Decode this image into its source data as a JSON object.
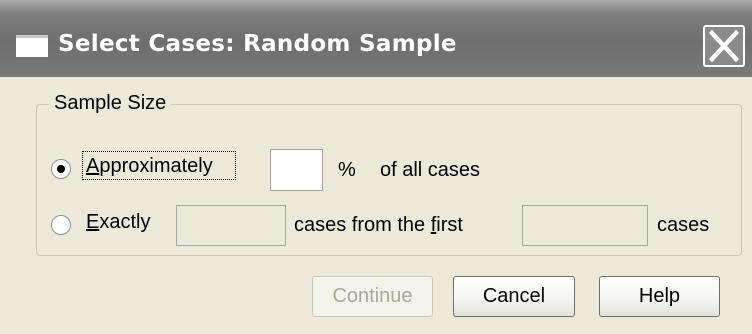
{
  "window": {
    "title": "Select Cases: Random Sample",
    "close_glyph": "✕"
  },
  "sample_size": {
    "group_label": "Sample Size",
    "approximately": {
      "label_prefix": "",
      "label_mnemonic": "A",
      "label_rest": "pproximately",
      "selected": true,
      "value": "",
      "percent_symbol": "%",
      "suffix": "of all cases"
    },
    "exactly": {
      "label_mnemonic": "E",
      "label_rest": "xactly",
      "selected": false,
      "count_value": "",
      "middle_prefix": "cases from the ",
      "middle_mnemonic": "f",
      "middle_rest": "irst",
      "first_value": "",
      "suffix": "cases"
    }
  },
  "buttons": {
    "continue": "Continue",
    "cancel": "Cancel",
    "help": "Help"
  },
  "colors": {
    "dialog_bg": "#ece9d8",
    "titlebar": "#777777",
    "disabled_text": "#aca899"
  },
  "icons": {
    "window_icon": "window-icon",
    "close": "close-icon",
    "radio_selected": "radio-selected-icon",
    "radio_unselected": "radio-unselected-icon"
  }
}
